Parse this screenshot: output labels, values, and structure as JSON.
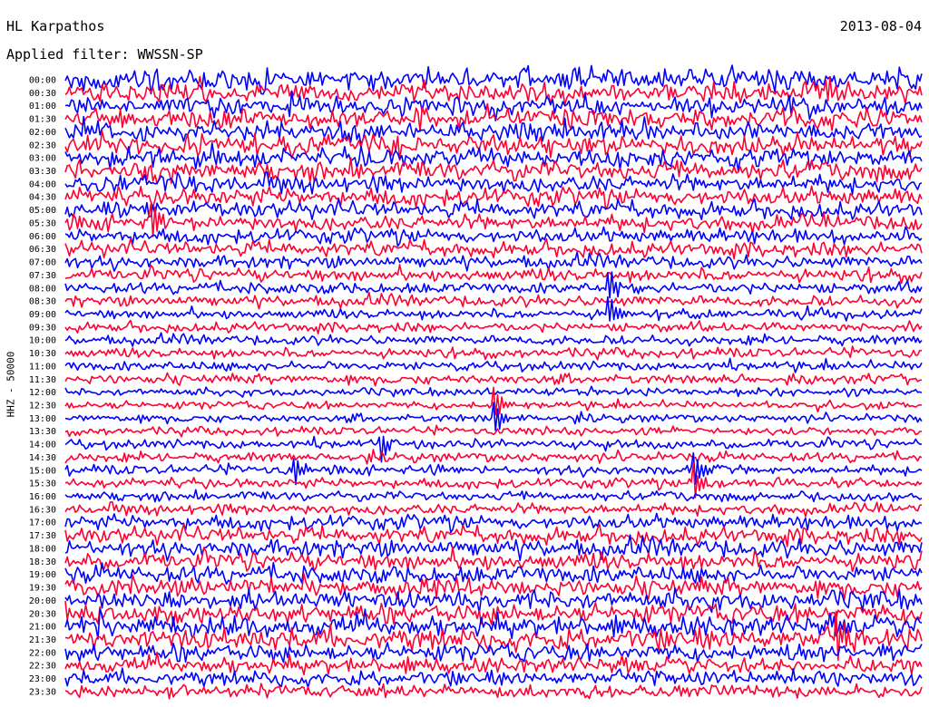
{
  "header": {
    "station": "HL Karpathos",
    "date": "2013-08-04",
    "filter": "Applied filter: WWSSN-SP"
  },
  "chart_data": {
    "type": "line",
    "title": "HL Karpathos",
    "subtitle": "Applied filter: WWSSN-SP",
    "date": "2013-08-04",
    "ylabel": "HHZ - 50000",
    "xlabel": "",
    "series_colors": [
      "#0000ff",
      "#ff0033"
    ],
    "rows": [
      "00:00",
      "00:30",
      "01:00",
      "01:30",
      "02:00",
      "02:30",
      "03:00",
      "03:30",
      "04:00",
      "04:30",
      "05:00",
      "05:30",
      "06:00",
      "06:30",
      "07:00",
      "07:30",
      "08:00",
      "08:30",
      "09:00",
      "09:30",
      "10:00",
      "10:30",
      "11:00",
      "11:30",
      "12:00",
      "12:30",
      "13:00",
      "13:30",
      "14:00",
      "14:30",
      "15:00",
      "15:30",
      "16:00",
      "16:30",
      "17:00",
      "17:30",
      "18:00",
      "18:30",
      "19:00",
      "19:30",
      "20:00",
      "20:30",
      "21:00",
      "21:30",
      "22:00",
      "22:30",
      "23:00",
      "23:30"
    ],
    "noise_amplitude": [
      13,
      13,
      12,
      12,
      12,
      12,
      12,
      12,
      11,
      11,
      10,
      10,
      9,
      9,
      8,
      8,
      7,
      7,
      6,
      6,
      6,
      6,
      6,
      6,
      5,
      5,
      5,
      5,
      6,
      6,
      6,
      6,
      6,
      7,
      9,
      10,
      11,
      11,
      11,
      11,
      12,
      12,
      13,
      13,
      11,
      10,
      9,
      8
    ],
    "events": [
      {
        "row": 11,
        "minute": 3
      },
      {
        "row": 16,
        "minute": 19
      },
      {
        "row": 18,
        "minute": 19
      },
      {
        "row": 25,
        "minute": 15
      },
      {
        "row": 26,
        "minute": 15
      },
      {
        "row": 28,
        "minute": 11
      },
      {
        "row": 30,
        "minute": 8
      },
      {
        "row": 30,
        "minute": 22
      },
      {
        "row": 31,
        "minute": 22
      },
      {
        "row": 43,
        "minute": 27
      }
    ]
  }
}
